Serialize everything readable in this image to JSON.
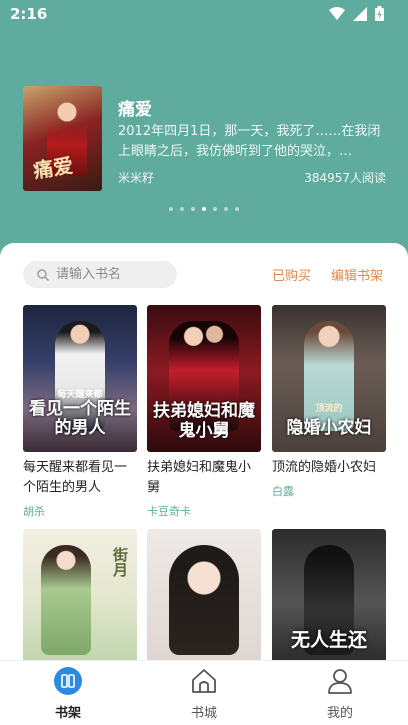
{
  "status": {
    "time": "2:16"
  },
  "featured": {
    "title": "痛爱",
    "description": "2012年四月1日，那一天，我死了……在我闭上眼睛之后，我仿佛听到了他的哭泣，…",
    "author": "米米籽",
    "reads": "384957人阅读",
    "cover_text": "痛爱",
    "carousel_count": 7,
    "carousel_active": 4
  },
  "shelf": {
    "search_placeholder": "请输入书名",
    "purchased_label": "已购买",
    "edit_label": "编辑书架",
    "books": [
      {
        "title": "每天醒来都看见一个陌生的男人",
        "author": "胡杀",
        "cover_text": "看见一个陌生的男人",
        "cover_sub": "每天醒来都"
      },
      {
        "title": "扶弟媳妇和魔鬼小舅",
        "author": "卡豆奇卡",
        "cover_text": "扶弟媳妇和魔鬼小舅",
        "cover_sub": ""
      },
      {
        "title": "顶流的隐婚小农妇",
        "author": "白露",
        "cover_text": "隐婚小农妇",
        "cover_sub": "顶流的"
      },
      {
        "title": "",
        "author": "",
        "cover_text": "街月",
        "cover_sub": ""
      },
      {
        "title": "",
        "author": "",
        "cover_text": "",
        "cover_sub": ""
      },
      {
        "title": "",
        "author": "",
        "cover_text": "无人生还",
        "cover_sub": ""
      }
    ]
  },
  "tabs": [
    {
      "label": "书架",
      "icon": "bookshelf-icon",
      "active": true
    },
    {
      "label": "书城",
      "icon": "home-icon",
      "active": false
    },
    {
      "label": "我的",
      "icon": "user-icon",
      "active": false
    }
  ],
  "colors": {
    "accent": "#5fab9d",
    "link": "#e0894a"
  }
}
